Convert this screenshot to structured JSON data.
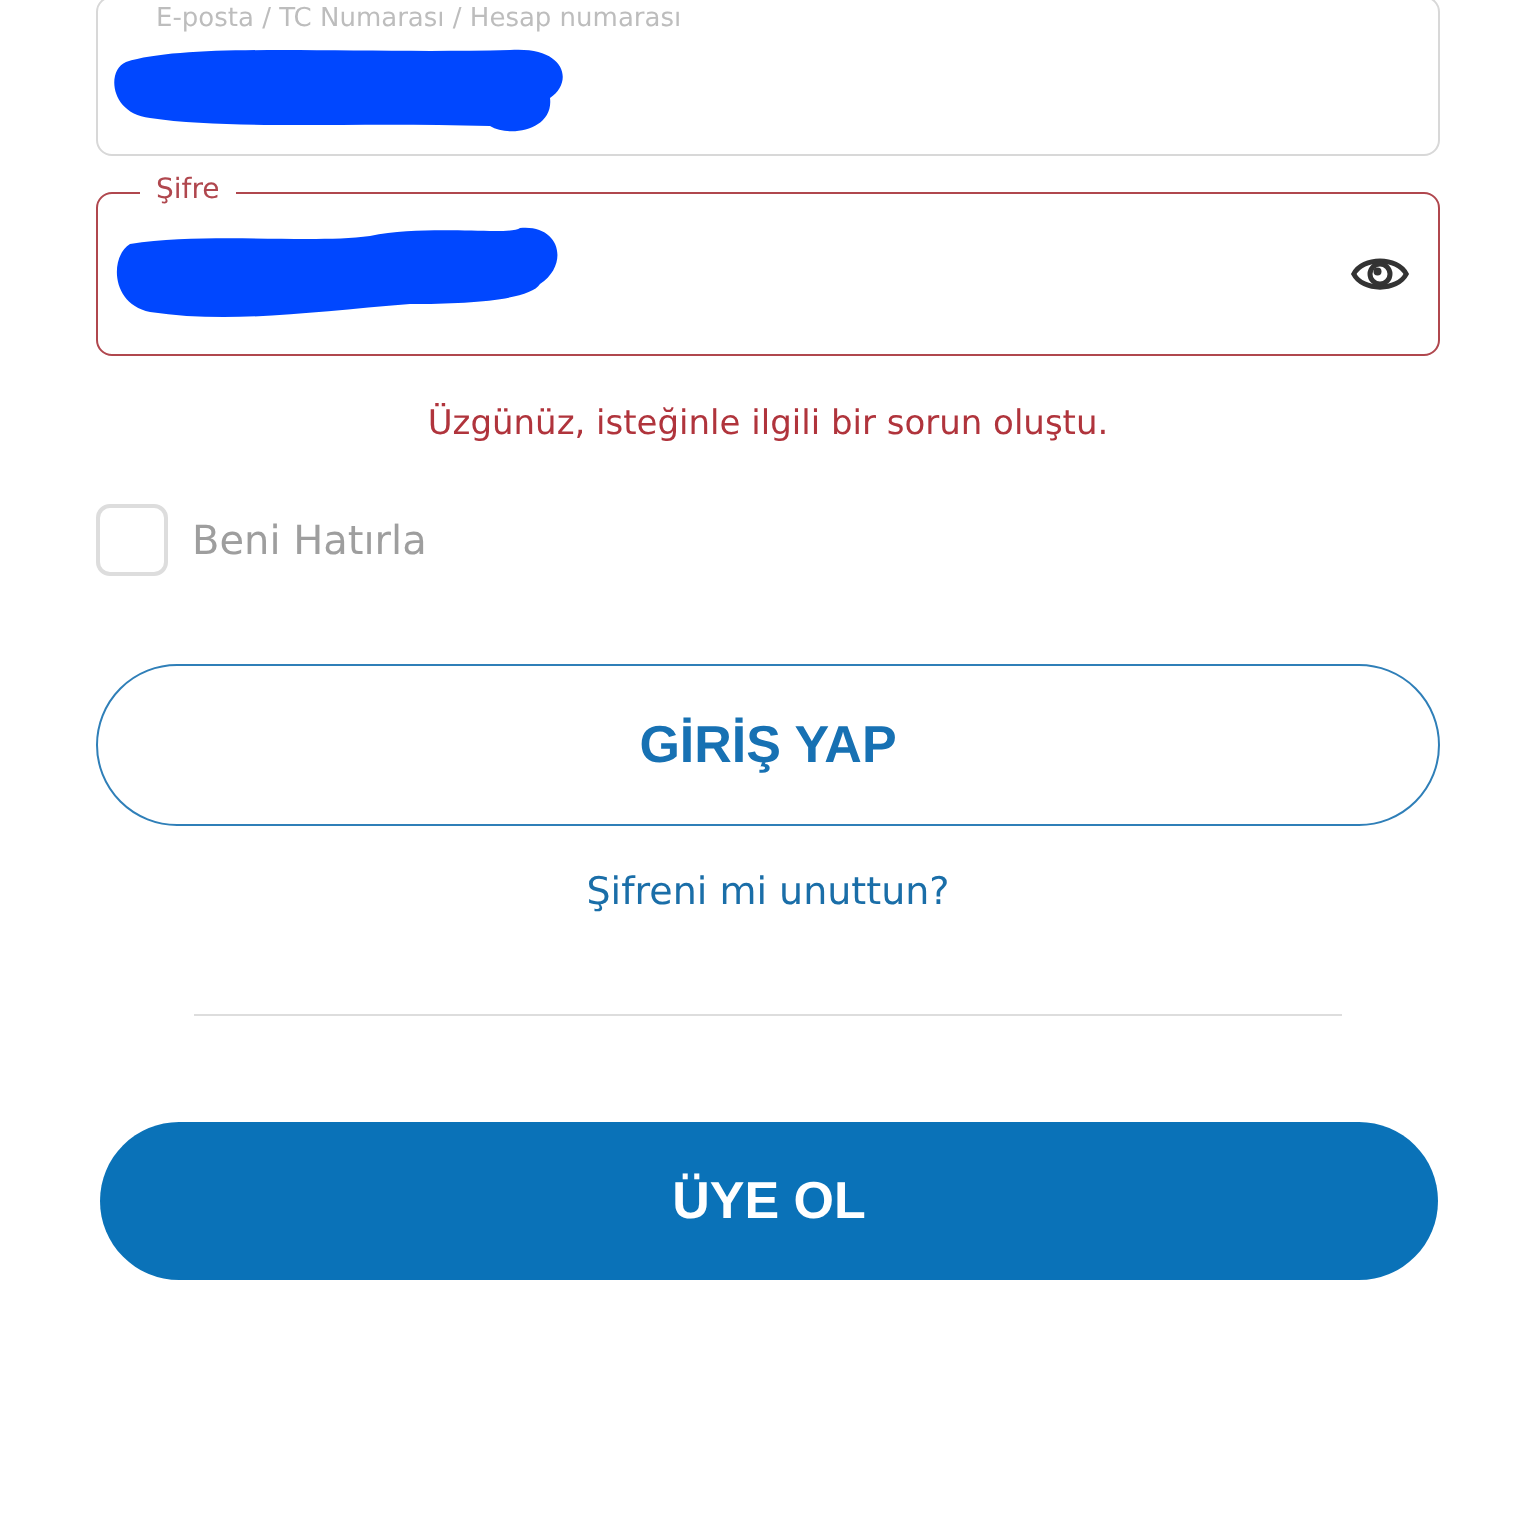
{
  "fields": [
    {
      "kind": "text",
      "label": "E-posta / TC Numarası / Hesap numarası",
      "error": false,
      "redacted": true
    },
    {
      "kind": "password",
      "label": "Şifre",
      "error": true,
      "redacted": true
    }
  ],
  "error_message": "Üzgünüz, isteğinle ilgili bir sorun oluştu.",
  "remember_me": {
    "label": "Beni Hatırla",
    "checked": false
  },
  "login_button": "GİRİŞ YAP",
  "forgot_link": "Şifreni mi unuttun?",
  "register_button": "ÜYE OL"
}
